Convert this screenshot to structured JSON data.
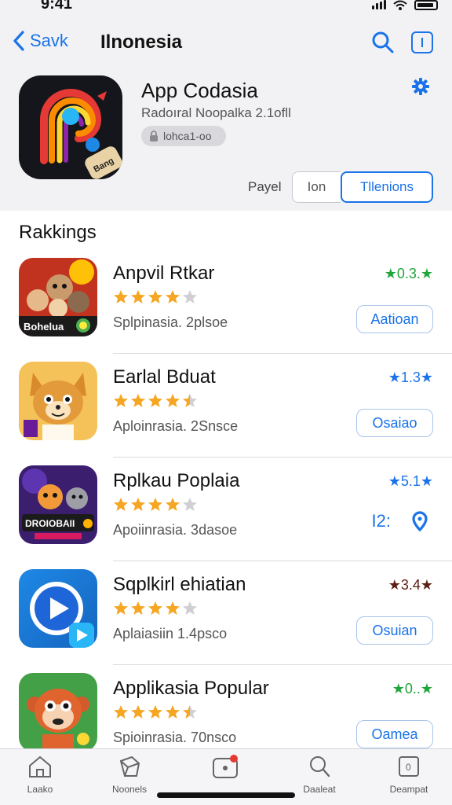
{
  "status": {
    "time": "9:41"
  },
  "nav": {
    "back_label": "Savk",
    "title": "Ilnonesia"
  },
  "hero": {
    "title": "App Codasia",
    "subtitle": "Radoıral Noopalka 2.1ofll",
    "badge": "lohca1-oo",
    "segment_label": "Payel",
    "segments": [
      "Ion",
      "Tllenions"
    ]
  },
  "section": {
    "title": "Rakkings"
  },
  "apps": [
    {
      "name": "Anpvil Rtkar",
      "rank": "★0.3.★",
      "rank_color": "#1fa53a",
      "meta": "Splpinasia. 2plsoe",
      "action": "Aatioan",
      "stars": 4
    },
    {
      "name": "Earlal Bduat",
      "rank": "★1.3★",
      "rank_color": "#1a73e8",
      "meta": "Aploinrasia. 2Snsce",
      "action": "Osaiao",
      "stars": 4.5
    },
    {
      "name": "Rplkau Poplaia",
      "rank": "★5.1★",
      "rank_color": "#1a73e8",
      "meta": "Apoiinrasia. 3dasoe",
      "action": "I2:",
      "stars": 4
    },
    {
      "name": "Sqplkirl ehiatian",
      "rank": "★3.4★",
      "rank_color": "#5b1f15",
      "meta": "Aplaiasiin 1.4psco",
      "action": "Osuian",
      "stars": 4
    },
    {
      "name": "Applikasia Popular",
      "rank": "★0..★",
      "rank_color": "#1fa53a",
      "meta": "Spioinrasia. 70nsco",
      "action": "Oamea",
      "stars": 4.5
    }
  ],
  "tabs": [
    {
      "label": "Laako",
      "icon": "home-icon"
    },
    {
      "label": "Noonels",
      "icon": "cube-icon"
    },
    {
      "label": "",
      "icon": "notification-box-icon"
    },
    {
      "label": "Daaleat",
      "icon": "search-icon"
    },
    {
      "label": "Deampat",
      "icon": "account-box-icon"
    }
  ],
  "colors": {
    "accent": "#1a73e8",
    "star": "#f5a623",
    "star_empty": "#cfcfd4"
  }
}
